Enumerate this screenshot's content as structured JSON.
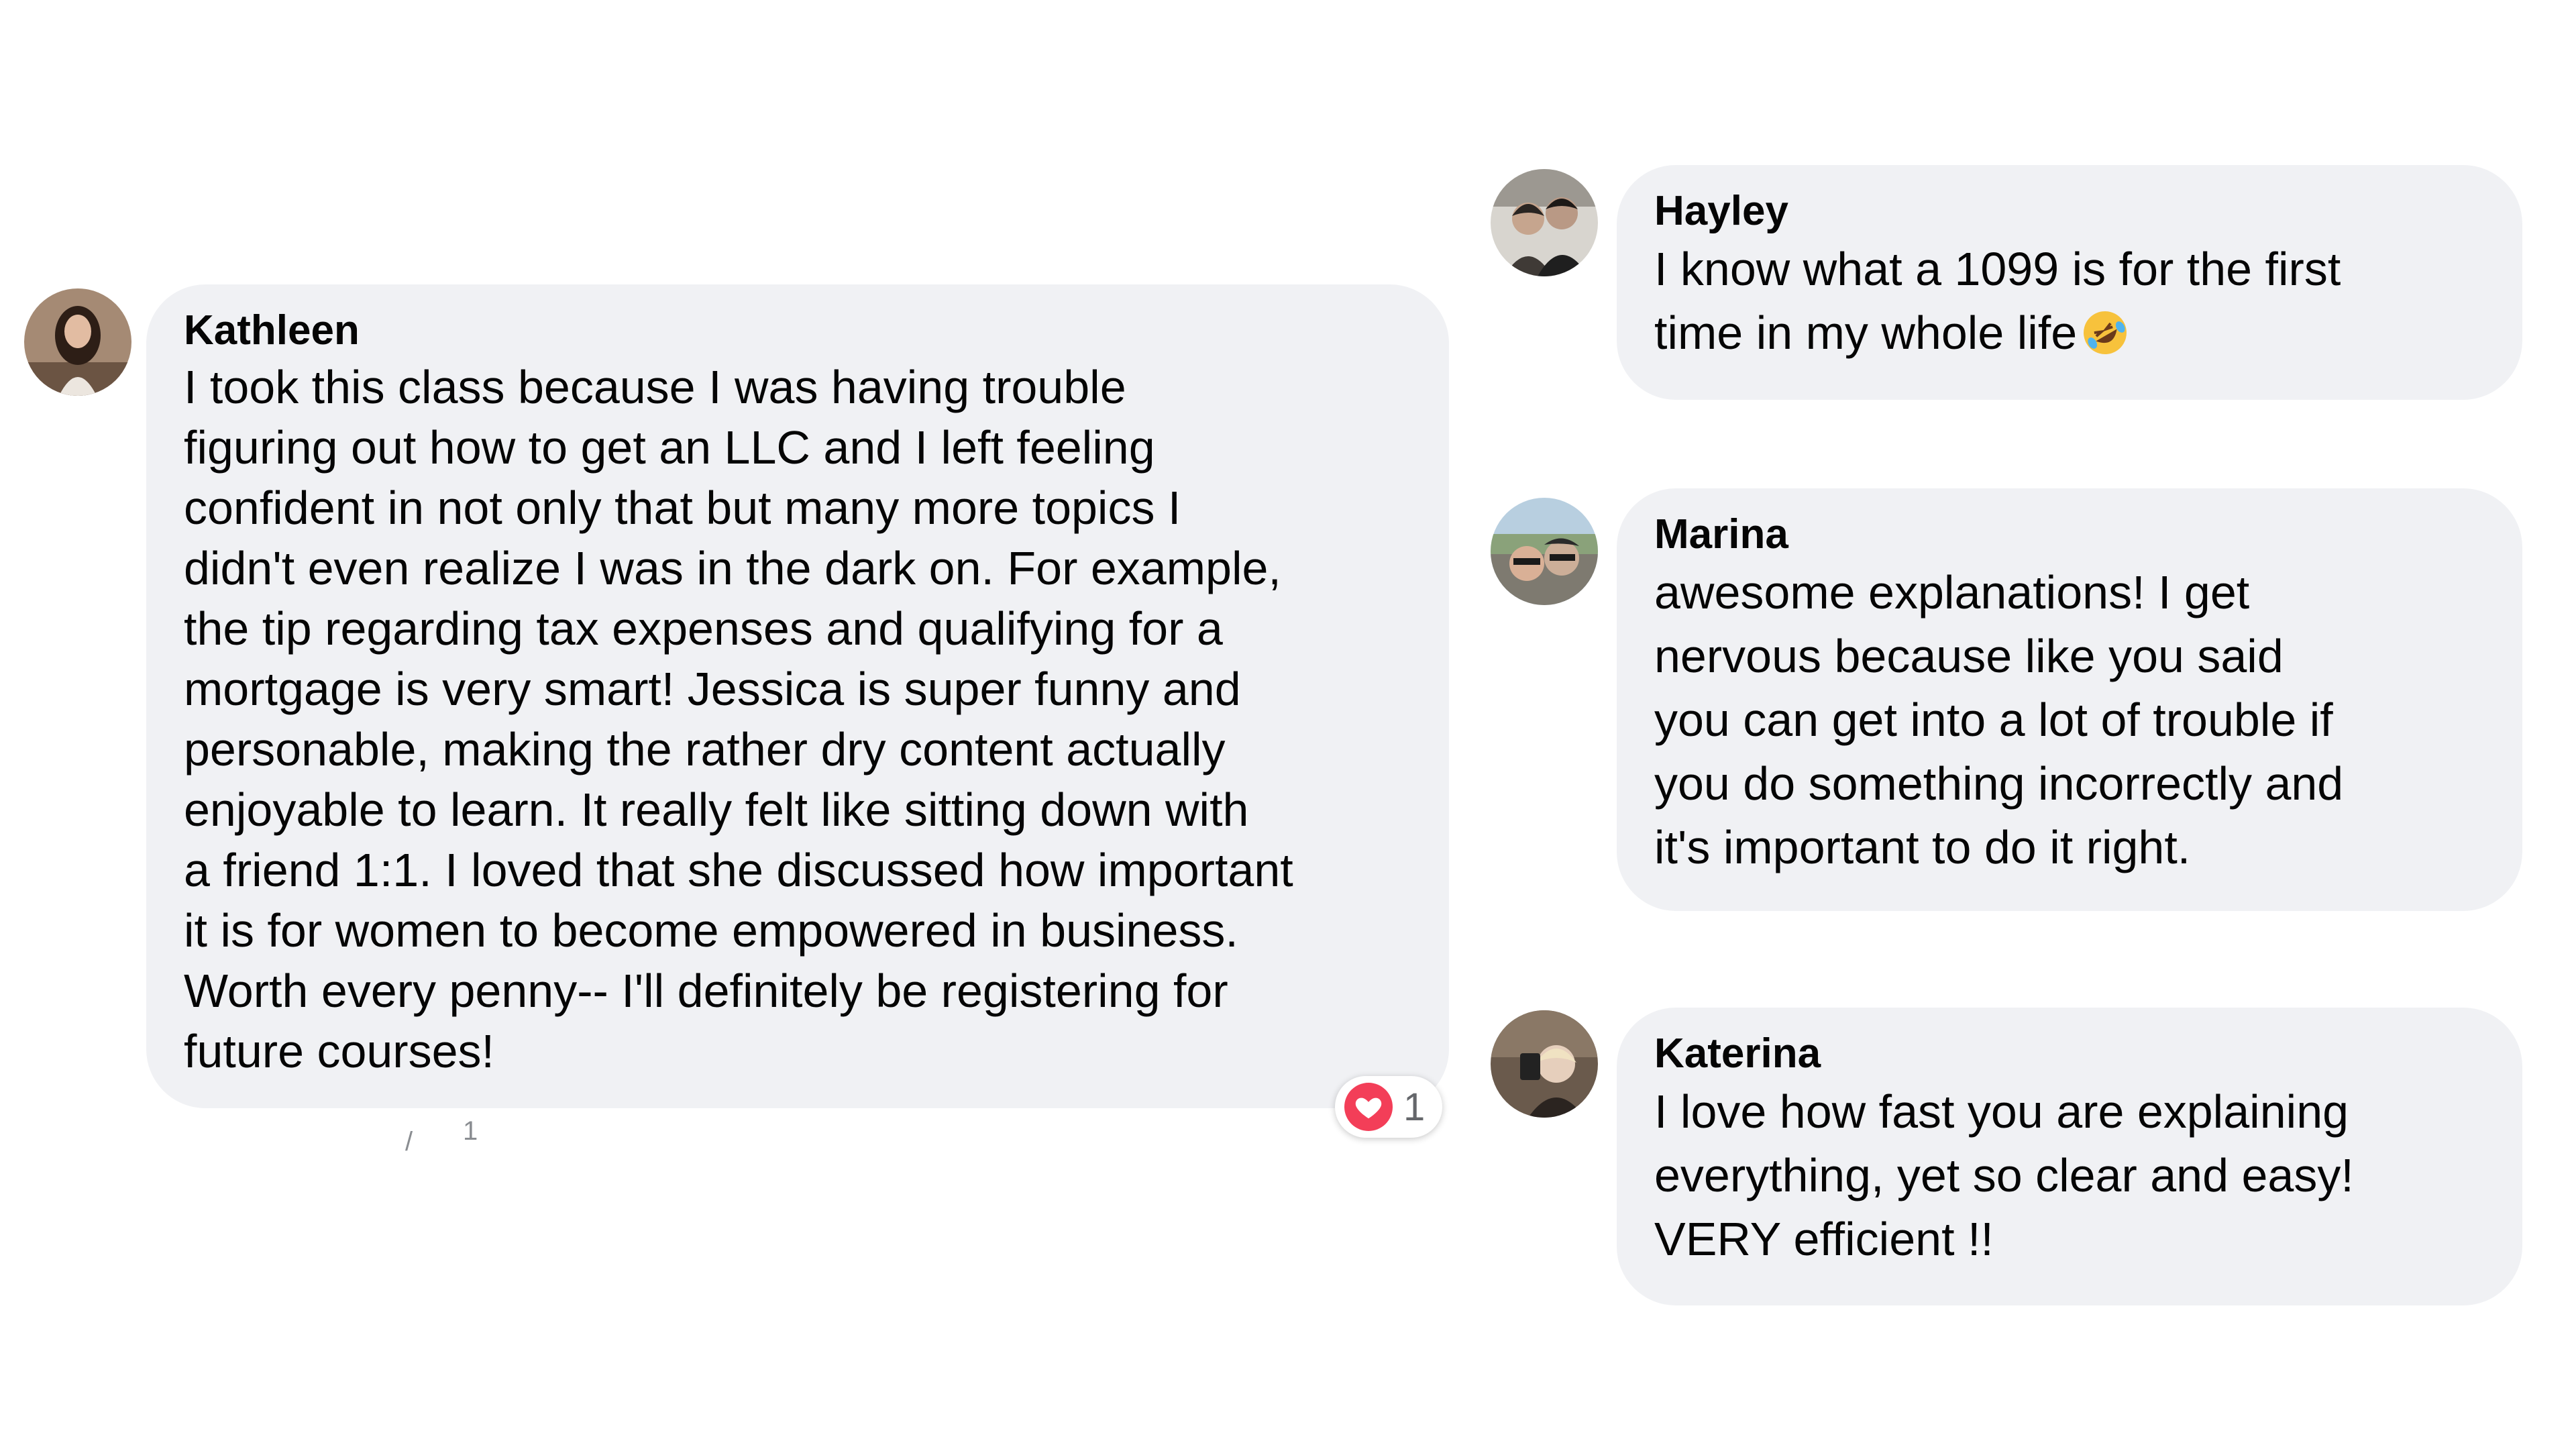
{
  "comments": [
    {
      "name": "Kathleen",
      "text": "I took this class because I was having trouble\nfiguring out how to get an LLC and I left feeling\nconfident in not only that but many more topics I\ndidn't even realize I was in the dark on. For example,\nthe tip regarding tax expenses and qualifying for a\nmortgage is very smart! Jessica is super funny and\npersonable, making the rather dry content actually\nenjoyable to learn. It really felt like sitting down with\na friend 1:1. I loved that she discussed how important\nit is for women to become empowered in business.\nWorth every penny-- I'll definitely be registering for\nfuture courses!",
      "reaction": {
        "icon": "heart-icon",
        "count": "1",
        "color": "#f33e58"
      },
      "footer_fragment": "1"
    },
    {
      "name": "Hayley",
      "text": "I know what a 1099 is for the first\ntime in my whole life",
      "emoji": "rolling-on-floor-laughing-icon"
    },
    {
      "name": "Marina",
      "text": "awesome explanations! I get\nnervous because like you said\nyou can get into a lot of trouble if\nyou do something incorrectly and\nit's important to do it right."
    },
    {
      "name": "Katerina",
      "text": "I love how fast you are explaining\neverything, yet so clear and easy!\nVERY efficient !!"
    }
  ],
  "colors": {
    "bubble": "#f0f1f4",
    "text": "#050505",
    "reaction_heart": "#f33e58",
    "muted": "#65676b"
  }
}
